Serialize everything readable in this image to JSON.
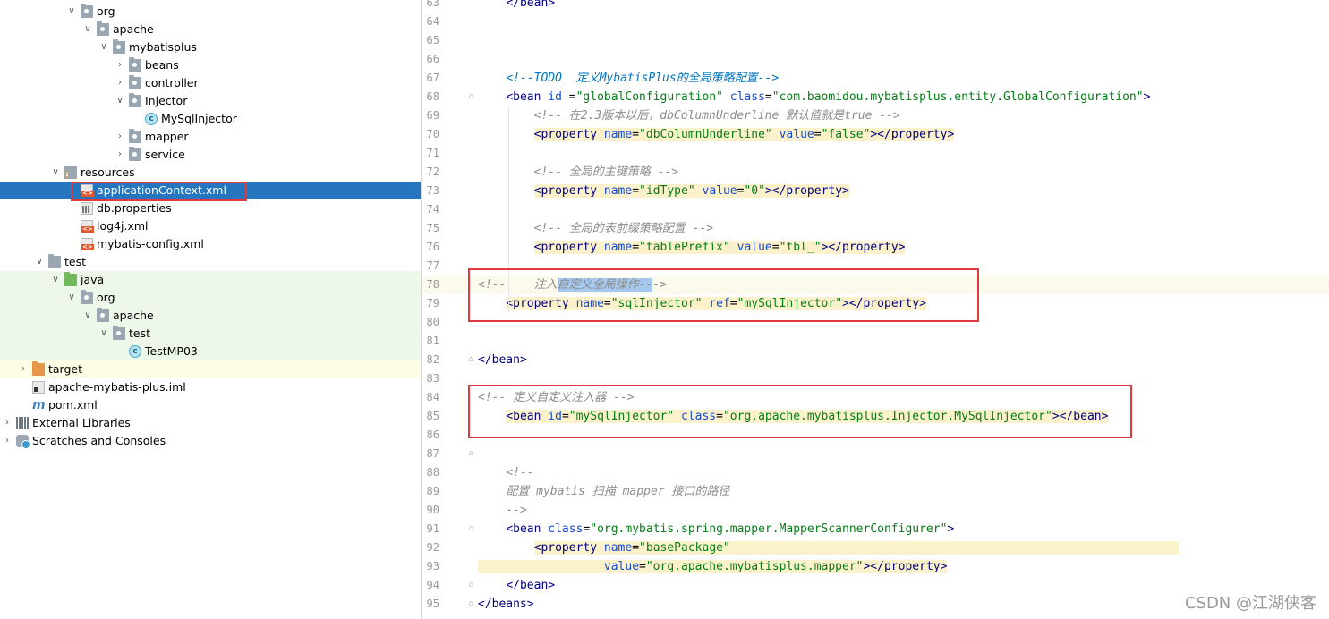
{
  "tree": {
    "items": [
      {
        "label": "org",
        "arrow": "v",
        "icon": "package-folder-icon",
        "depth": 4
      },
      {
        "label": "apache",
        "arrow": "v",
        "icon": "package-folder-icon",
        "depth": 5
      },
      {
        "label": "mybatisplus",
        "arrow": "v",
        "icon": "package-folder-icon",
        "depth": 6
      },
      {
        "label": "beans",
        "arrow": ">",
        "icon": "package-folder-icon",
        "depth": 7
      },
      {
        "label": "controller",
        "arrow": ">",
        "icon": "package-folder-icon",
        "depth": 7
      },
      {
        "label": "Injector",
        "arrow": "v",
        "icon": "package-folder-icon",
        "depth": 7
      },
      {
        "label": "MySqlInjector",
        "arrow": "",
        "icon": "java-class-icon",
        "depth": 8
      },
      {
        "label": "mapper",
        "arrow": ">",
        "icon": "package-folder-icon",
        "depth": 7
      },
      {
        "label": "service",
        "arrow": ">",
        "icon": "package-folder-icon",
        "depth": 7
      },
      {
        "label": "resources",
        "arrow": "v",
        "icon": "resources-folder-icon",
        "depth": 3
      },
      {
        "label": "applicationContext.xml",
        "arrow": "",
        "icon": "spring-xml-file-icon",
        "depth": 4
      },
      {
        "label": "db.properties",
        "arrow": "",
        "icon": "properties-file-icon",
        "depth": 4
      },
      {
        "label": "log4j.xml",
        "arrow": "",
        "icon": "xml-file-icon",
        "depth": 4
      },
      {
        "label": "mybatis-config.xml",
        "arrow": "",
        "icon": "xml-file-icon",
        "depth": 4
      },
      {
        "label": "test",
        "arrow": "v",
        "icon": "folder-icon",
        "depth": 2
      },
      {
        "label": "java",
        "arrow": "v",
        "icon": "test-source-folder-icon",
        "depth": 3
      },
      {
        "label": "org",
        "arrow": "v",
        "icon": "package-folder-icon",
        "depth": 4
      },
      {
        "label": "apache",
        "arrow": "v",
        "icon": "package-folder-icon",
        "depth": 5
      },
      {
        "label": "test",
        "arrow": "v",
        "icon": "package-folder-icon",
        "depth": 6
      },
      {
        "label": "TestMP03",
        "arrow": "",
        "icon": "java-test-class-icon",
        "depth": 7
      },
      {
        "label": "target",
        "arrow": ">",
        "icon": "excluded-folder-icon",
        "depth": 1
      },
      {
        "label": "apache-mybatis-plus.iml",
        "arrow": "",
        "icon": "iml-file-icon",
        "depth": 1
      },
      {
        "label": "pom.xml",
        "arrow": "",
        "icon": "maven-icon",
        "depth": 1
      },
      {
        "label": "External Libraries",
        "arrow": ">",
        "icon": "libraries-icon",
        "depth": 0
      },
      {
        "label": "Scratches and Consoles",
        "arrow": ">",
        "icon": "scratches-icon",
        "depth": 0
      }
    ]
  },
  "editor": {
    "lines": [
      {
        "n": "63",
        "segs": [
          {
            "t": "    ",
            "c": ""
          },
          {
            "t": "</bean>",
            "c": "c-tag"
          }
        ]
      },
      {
        "n": "64",
        "segs": []
      },
      {
        "n": "65",
        "segs": []
      },
      {
        "n": "66",
        "segs": []
      },
      {
        "n": "67",
        "segs": [
          {
            "t": "    ",
            "c": ""
          },
          {
            "t": "<!--TODO  定义MybatisPlus的全局策略配置-->",
            "c": "c-todo"
          }
        ]
      },
      {
        "n": "68",
        "segs": [
          {
            "t": "    ",
            "c": ""
          },
          {
            "t": "<bean ",
            "c": "c-tag"
          },
          {
            "t": "id ",
            "c": "c-attr"
          },
          {
            "t": "=",
            "c": ""
          },
          {
            "t": "\"globalConfiguration\" ",
            "c": "c-val"
          },
          {
            "t": "class",
            "c": "c-attr"
          },
          {
            "t": "=",
            "c": ""
          },
          {
            "t": "\"com.baomidou.mybatisplus.entity.GlobalConfiguration\"",
            "c": "c-val"
          },
          {
            "t": ">",
            "c": "c-tag"
          }
        ]
      },
      {
        "n": "69",
        "segs": [
          {
            "t": "        ",
            "c": ""
          },
          {
            "t": "<!-- 在2.3版本以后，dbColumnUnderline 默认值就是true -->",
            "c": "c-cmt"
          }
        ]
      },
      {
        "n": "70",
        "segs": [
          {
            "t": "        ",
            "c": ""
          },
          {
            "t": "<property ",
            "c": "c-tag hl"
          },
          {
            "t": "name",
            "c": "c-attr hl"
          },
          {
            "t": "=",
            "c": "hl"
          },
          {
            "t": "\"dbColumnUnderline\" ",
            "c": "c-val hl"
          },
          {
            "t": "value",
            "c": "c-attr hl"
          },
          {
            "t": "=",
            "c": "hl"
          },
          {
            "t": "\"false\"",
            "c": "c-val hl"
          },
          {
            "t": "></property>",
            "c": "c-tag hl"
          }
        ]
      },
      {
        "n": "71",
        "segs": []
      },
      {
        "n": "72",
        "segs": [
          {
            "t": "        ",
            "c": ""
          },
          {
            "t": "<!-- 全局的主键策略 -->",
            "c": "c-cmt"
          }
        ]
      },
      {
        "n": "73",
        "segs": [
          {
            "t": "        ",
            "c": ""
          },
          {
            "t": "<property ",
            "c": "c-tag hl"
          },
          {
            "t": "name",
            "c": "c-attr hl"
          },
          {
            "t": "=",
            "c": "hl"
          },
          {
            "t": "\"idType\" ",
            "c": "c-val hl"
          },
          {
            "t": "value",
            "c": "c-attr hl"
          },
          {
            "t": "=",
            "c": "hl"
          },
          {
            "t": "\"0\"",
            "c": "c-val hl"
          },
          {
            "t": "></property>",
            "c": "c-tag hl"
          }
        ]
      },
      {
        "n": "74",
        "segs": []
      },
      {
        "n": "75",
        "segs": [
          {
            "t": "        ",
            "c": ""
          },
          {
            "t": "<!-- 全局的表前缀策略配置 -->",
            "c": "c-cmt"
          }
        ]
      },
      {
        "n": "76",
        "segs": [
          {
            "t": "        ",
            "c": ""
          },
          {
            "t": "<property ",
            "c": "c-tag hl"
          },
          {
            "t": "name",
            "c": "c-attr hl"
          },
          {
            "t": "=",
            "c": "hl"
          },
          {
            "t": "\"tablePrefix\" ",
            "c": "c-val hl"
          },
          {
            "t": "value",
            "c": "c-attr hl"
          },
          {
            "t": "=",
            "c": "hl"
          },
          {
            "t": "\"tbl_\"",
            "c": "c-val hl"
          },
          {
            "t": "></property>",
            "c": "c-tag hl"
          }
        ]
      },
      {
        "n": "77",
        "segs": []
      },
      {
        "n": "78",
        "cur": true,
        "segs": [
          {
            "t": "<!--    注入",
            "c": "c-cmt"
          },
          {
            "t": "自定义全局操作--",
            "c": "c-cmt c-sel"
          },
          {
            "t": "->",
            "c": "c-cmt"
          }
        ]
      },
      {
        "n": "79",
        "segs": [
          {
            "t": "    ",
            "c": ""
          },
          {
            "t": "<property ",
            "c": "c-tag hl"
          },
          {
            "t": "name",
            "c": "c-attr hl"
          },
          {
            "t": "=",
            "c": "hl"
          },
          {
            "t": "\"sqlInjector\" ",
            "c": "c-val hl"
          },
          {
            "t": "ref",
            "c": "c-attr hl"
          },
          {
            "t": "=",
            "c": "hl"
          },
          {
            "t": "\"mySqlInjector\"",
            "c": "c-val hl"
          },
          {
            "t": "></property>",
            "c": "c-tag hl"
          }
        ]
      },
      {
        "n": "80",
        "segs": []
      },
      {
        "n": "81",
        "segs": []
      },
      {
        "n": "82",
        "segs": [
          {
            "t": "</bean>",
            "c": "c-tag"
          }
        ]
      },
      {
        "n": "83",
        "segs": []
      },
      {
        "n": "84",
        "segs": [
          {
            "t": "<!-- 定义自定义注入器 -->",
            "c": "c-cmt"
          }
        ]
      },
      {
        "n": "85",
        "segs": [
          {
            "t": "    ",
            "c": ""
          },
          {
            "t": "<bean ",
            "c": "c-tag hl"
          },
          {
            "t": "id",
            "c": "c-attr hl"
          },
          {
            "t": "=",
            "c": "hl"
          },
          {
            "t": "\"mySqlInjector\" ",
            "c": "c-val hl"
          },
          {
            "t": "class",
            "c": "c-attr hl"
          },
          {
            "t": "=",
            "c": "hl"
          },
          {
            "t": "\"org.apache.mybatisplus.Injector.MySqlInjector\"",
            "c": "c-val hl"
          },
          {
            "t": "></bean>",
            "c": "c-tag hl"
          }
        ]
      },
      {
        "n": "86",
        "segs": []
      },
      {
        "n": "87",
        "segs": []
      },
      {
        "n": "88",
        "segs": [
          {
            "t": "    ",
            "c": ""
          },
          {
            "t": "<!--",
            "c": "c-cmt"
          }
        ]
      },
      {
        "n": "89",
        "segs": [
          {
            "t": "    ",
            "c": ""
          },
          {
            "t": "配置 mybatis 扫描 mapper 接口的路径",
            "c": "c-cmt"
          }
        ]
      },
      {
        "n": "90",
        "segs": [
          {
            "t": "    ",
            "c": ""
          },
          {
            "t": "-->",
            "c": "c-cmt"
          }
        ]
      },
      {
        "n": "91",
        "segs": [
          {
            "t": "    ",
            "c": ""
          },
          {
            "t": "<bean ",
            "c": "c-tag"
          },
          {
            "t": "class",
            "c": "c-attr"
          },
          {
            "t": "=",
            "c": ""
          },
          {
            "t": "\"org.mybatis.spring.mapper.MapperScannerConfigurer\"",
            "c": "c-val"
          },
          {
            "t": ">",
            "c": "c-tag"
          }
        ]
      },
      {
        "n": "92",
        "segs": [
          {
            "t": "        ",
            "c": ""
          },
          {
            "t": "<property ",
            "c": "c-tag hl"
          },
          {
            "t": "name",
            "c": "c-attr hl"
          },
          {
            "t": "=",
            "c": "hl"
          },
          {
            "t": "\"basePackage\"",
            "c": "c-val hl"
          },
          {
            "t": "                                                                ",
            "c": "hl"
          }
        ]
      },
      {
        "n": "93",
        "segs": [
          {
            "t": "                  ",
            "c": "hl"
          },
          {
            "t": "value",
            "c": "c-attr hl"
          },
          {
            "t": "=",
            "c": "hl"
          },
          {
            "t": "\"org.apache.mybatisplus.mapper\"",
            "c": "c-val hl"
          },
          {
            "t": "></property>",
            "c": "c-tag hl"
          }
        ]
      },
      {
        "n": "94",
        "segs": [
          {
            "t": "    ",
            "c": ""
          },
          {
            "t": "</bean>",
            "c": "c-tag"
          }
        ]
      },
      {
        "n": "95",
        "segs": [
          {
            "t": "</beans>",
            "c": "c-tag"
          }
        ]
      }
    ]
  },
  "watermark": "CSDN @江湖侠客"
}
